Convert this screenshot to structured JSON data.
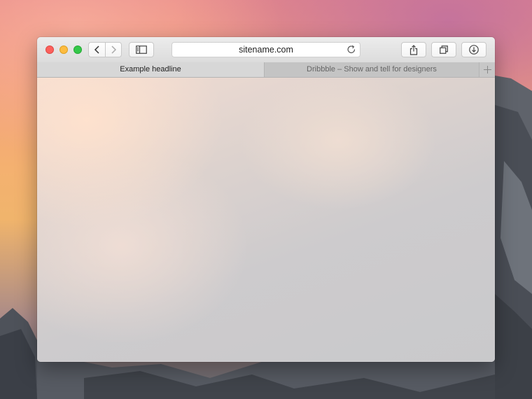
{
  "window": {
    "traffic_lights": [
      "close",
      "minimize",
      "zoom"
    ],
    "toolbar_icons": {
      "back": "chevron-left-icon",
      "forward": "chevron-right-icon",
      "sidebar": "sidebar-icon",
      "reload": "reload-icon",
      "share": "share-icon",
      "tabs_overview": "tabs-overview-icon",
      "downloads": "download-icon"
    },
    "address_bar": {
      "url_text": "sitename.com"
    }
  },
  "tabs": [
    {
      "label": "Example headline",
      "active": true
    },
    {
      "label": "Dribbble – Show and tell for designers",
      "active": false
    }
  ],
  "new_tab_icon": "plus-icon",
  "colors": {
    "close": "#fc605c",
    "minimize": "#fdbc40",
    "zoom": "#34c84a"
  }
}
